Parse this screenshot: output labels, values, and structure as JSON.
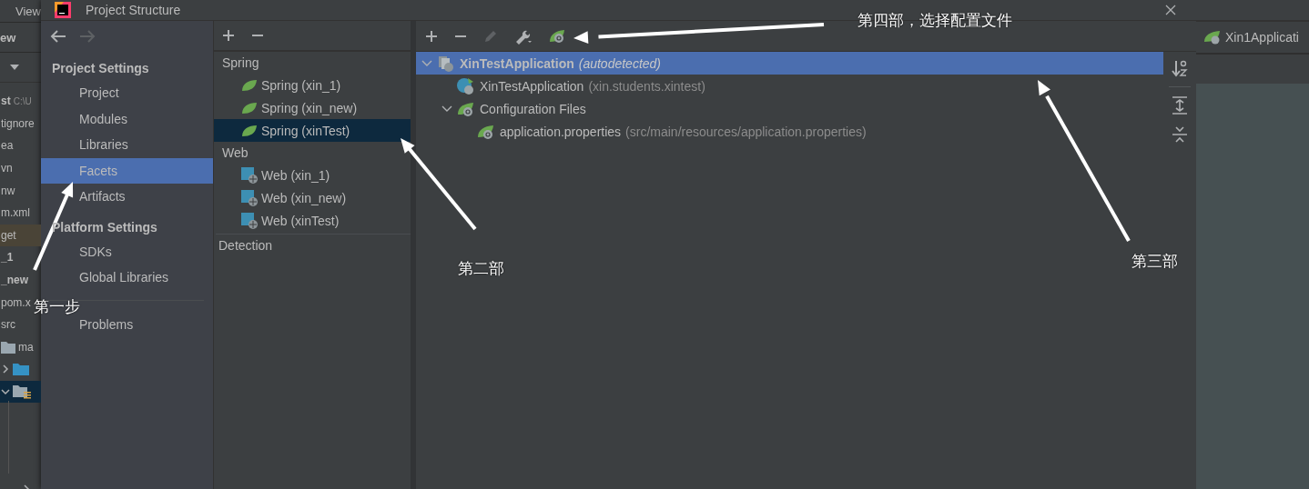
{
  "ide_left": {
    "menu": "View",
    "breadcrumb": "ew",
    "rows": [
      {
        "text": "st",
        "detail": "C:\\U",
        "kind": "bold",
        "selected": false
      },
      {
        "text": "tignore",
        "kind": "file",
        "selected": false
      },
      {
        "text": "ea",
        "kind": "file",
        "selected": false
      },
      {
        "text": "vn",
        "kind": "file",
        "selected": false
      },
      {
        "text": "nw",
        "kind": "file",
        "selected": false
      },
      {
        "text": "m.xml",
        "kind": "file",
        "selected": false
      },
      {
        "text": "get",
        "kind": "ignored",
        "selected": false
      },
      {
        "text": "_1",
        "kind": "bold",
        "selected": false
      },
      {
        "text": "_new",
        "kind": "bold",
        "selected": false
      },
      {
        "text": "pom.x",
        "kind": "file",
        "selected": false
      },
      {
        "text": "src",
        "kind": "file",
        "selected": false
      },
      {
        "text": "ma",
        "kind": "folder",
        "selected": false
      },
      {
        "kind": "source-folder",
        "expanded": false,
        "selected": false
      },
      {
        "kind": "package-folder",
        "expanded": true,
        "selected": true
      }
    ]
  },
  "window": {
    "title": "Project Structure"
  },
  "sidebar": {
    "sections": [
      {
        "title": "Project Settings",
        "items": [
          {
            "label": "Project",
            "selected": false
          },
          {
            "label": "Modules",
            "selected": false
          },
          {
            "label": "Libraries",
            "selected": false
          },
          {
            "label": "Facets",
            "selected": true
          },
          {
            "label": "Artifacts",
            "selected": false
          }
        ]
      },
      {
        "title": "Platform Settings",
        "items": [
          {
            "label": "SDKs",
            "selected": false
          },
          {
            "label": "Global Libraries",
            "selected": false
          }
        ]
      }
    ],
    "footer_items": [
      {
        "label": "Problems",
        "selected": false
      }
    ]
  },
  "facets": {
    "groups": [
      {
        "title": "Spring",
        "items": [
          {
            "label": "Spring (xin_1)",
            "kind": "spring",
            "selected": false
          },
          {
            "label": "Spring (xin_new)",
            "kind": "spring",
            "selected": false
          },
          {
            "label": "Spring (xinTest)",
            "kind": "spring",
            "selected": true
          }
        ]
      },
      {
        "title": "Web",
        "items": [
          {
            "label": "Web (xin_1)",
            "kind": "web",
            "selected": false
          },
          {
            "label": "Web (xin_new)",
            "kind": "web",
            "selected": false
          },
          {
            "label": "Web (xinTest)",
            "kind": "web",
            "selected": false
          }
        ]
      }
    ],
    "footer": "Detection"
  },
  "context_tree": [
    {
      "label": "XinTestApplication",
      "detail": "(autodetected)",
      "kind": "context",
      "expanded": true,
      "selected": true,
      "children": [
        {
          "label": "XinTestApplication",
          "detail": "(xin.students.xintest)",
          "kind": "app-class",
          "selected": false
        },
        {
          "label": "Configuration Files",
          "kind": "config-folder",
          "expanded": true,
          "selected": false,
          "children": [
            {
              "label": "application.properties",
              "detail": "(src/main/resources/application.properties)",
              "kind": "properties",
              "selected": false
            }
          ]
        }
      ]
    }
  ],
  "ide_right": {
    "tab": "Xin1Applicati"
  },
  "annotations": [
    {
      "text": "第一步",
      "kind": "step1"
    },
    {
      "text": "第二部",
      "kind": "step2"
    },
    {
      "text": "第三部",
      "kind": "step3"
    },
    {
      "text": "第四部，选择配置文件",
      "kind": "step4"
    }
  ]
}
